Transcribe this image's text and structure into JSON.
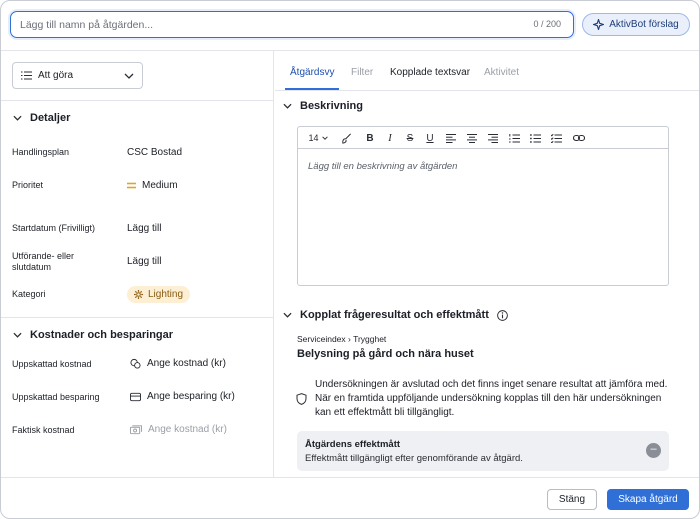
{
  "header": {
    "title_placeholder": "Lägg till namn på åtgärden...",
    "char_count": "0 / 200",
    "aktivbot_label": "AktivBot förslag"
  },
  "status": {
    "selected": "Att göra"
  },
  "details": {
    "title": "Detaljer",
    "rows": [
      {
        "label": "Handlingsplan",
        "value": "CSC Bostad"
      },
      {
        "label": "Prioritet",
        "value": "Medium"
      },
      {
        "label": "Startdatum (Frivilligt)",
        "value": "Lägg till"
      },
      {
        "label": "Utförande- eller slutdatum",
        "value": "Lägg till"
      },
      {
        "label": "Kategori",
        "value": "Lighting"
      }
    ]
  },
  "costs": {
    "title": "Kostnader och besparingar",
    "rows": [
      {
        "label": "Uppskattad kostnad",
        "value": "Ange kostnad (kr)"
      },
      {
        "label": "Uppskattad besparing",
        "value": "Ange besparing (kr)"
      },
      {
        "label": "Faktisk kostnad",
        "value": "Ange kostnad (kr)"
      }
    ]
  },
  "tabs": [
    {
      "label": "Åtgärdsvy"
    },
    {
      "label": "Filter"
    },
    {
      "label": "Kopplade textsvar"
    },
    {
      "label": "Aktivitet"
    }
  ],
  "description": {
    "title": "Beskrivning",
    "font_size": "14",
    "placeholder": "Lägg till en beskrivning av åtgärden"
  },
  "linked": {
    "title": "Kopplat fråg­eresultat och effektmått",
    "breadcrumb": "Serviceindex › Trygghet",
    "question": "Belysning på gård och nära huset",
    "info": "Undersökningen är avslutad och det finns inget senare resultat att jämföra med. När en framtida uppföljande undersökning kopplas till den här undersökningen kan ett effektmått bli tillgängligt.",
    "effect_title": "Åtgärdens effektmått",
    "effect_text": "Effektmått tillgängligt efter genomförande av åtgärd.",
    "effect_dot": "–"
  },
  "footer": {
    "close_label": "Stäng",
    "create_label": "Skapa åtgärd"
  },
  "colors": {
    "accent": "#2f6fd6",
    "priority_medium": "#e0a32b",
    "category_bg": "#fcefd4"
  }
}
